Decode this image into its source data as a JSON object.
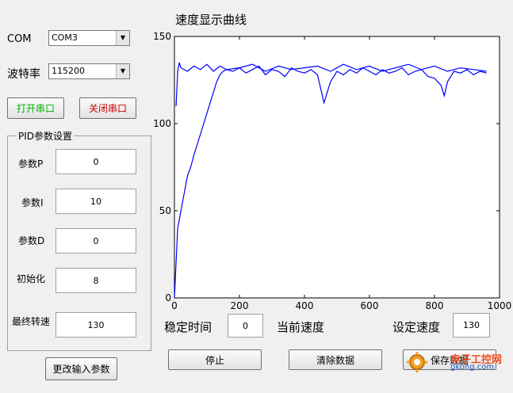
{
  "serial": {
    "com_label": "COM",
    "com_value": "COM3",
    "baud_label": "波特率",
    "baud_value": "115200",
    "open_label": "打开串口",
    "close_label": "关闭串口",
    "open_color": "#00b000",
    "close_color": "#d00000"
  },
  "pid": {
    "title": "PID参数设置",
    "p_label": "参数P",
    "p_value": "0",
    "i_label": "参数I",
    "i_value": "10",
    "d_label": "参数D",
    "d_value": "0",
    "init_label": "初始化",
    "init_value": "8",
    "final_label": "最终转速",
    "final_value": "130",
    "apply_label": "更改输入参数"
  },
  "status": {
    "settle_label": "稳定时间",
    "settle_value": "0",
    "current_label": "当前速度",
    "set_label": "设定速度",
    "set_value": "130"
  },
  "actions": {
    "stop_label": "停止",
    "clear_label": "清除数据",
    "save_label": "保存数据"
  },
  "watermark": {
    "text": "电子工控网",
    "url": "gkong.com"
  },
  "chart_data": {
    "type": "line",
    "title": "速度显示曲线",
    "xlabel": "",
    "ylabel": "",
    "xlim": [
      0,
      1000
    ],
    "ylim": [
      0,
      150
    ],
    "x_ticks": [
      0,
      200,
      400,
      600,
      800,
      1000
    ],
    "y_ticks": [
      0,
      50,
      100,
      150
    ],
    "grid": false,
    "series_color": "#0000ff",
    "series": [
      {
        "x": [
          0,
          5,
          10,
          15,
          20,
          30,
          40,
          50,
          60,
          70,
          80,
          90,
          100,
          110,
          120,
          130,
          140,
          150,
          160,
          180,
          200,
          220,
          240,
          260,
          280,
          300,
          320,
          340,
          360,
          380,
          400,
          420,
          440,
          460,
          470,
          480,
          500,
          520,
          540,
          560,
          580,
          600,
          620,
          640,
          660,
          680,
          700,
          720,
          740,
          760,
          780,
          800,
          820,
          830,
          840,
          860,
          880,
          900,
          920,
          940,
          960
        ],
        "y": [
          0,
          20,
          40,
          45,
          50,
          60,
          70,
          75,
          82,
          88,
          94,
          100,
          106,
          112,
          118,
          124,
          128,
          130,
          131,
          130,
          132,
          129,
          131,
          133,
          128,
          131,
          130,
          127,
          132,
          130,
          129,
          131,
          128,
          112,
          118,
          124,
          130,
          128,
          131,
          129,
          132,
          130,
          128,
          131,
          129,
          130,
          132,
          128,
          130,
          131,
          127,
          126,
          122,
          116,
          124,
          130,
          129,
          131,
          128,
          130,
          129
        ]
      },
      {
        "x": [
          5,
          10,
          15,
          20,
          40,
          60,
          80,
          100,
          120,
          140,
          160,
          200,
          240,
          280,
          320,
          360,
          400,
          440,
          480,
          520,
          560,
          600,
          640,
          680,
          720,
          760,
          800,
          840,
          880,
          920,
          960
        ],
        "y": [
          110,
          130,
          135,
          132,
          130,
          133,
          131,
          134,
          130,
          133,
          131,
          132,
          134,
          130,
          133,
          131,
          132,
          133,
          130,
          134,
          131,
          133,
          130,
          132,
          134,
          131,
          133,
          130,
          132,
          131,
          130
        ]
      }
    ]
  }
}
